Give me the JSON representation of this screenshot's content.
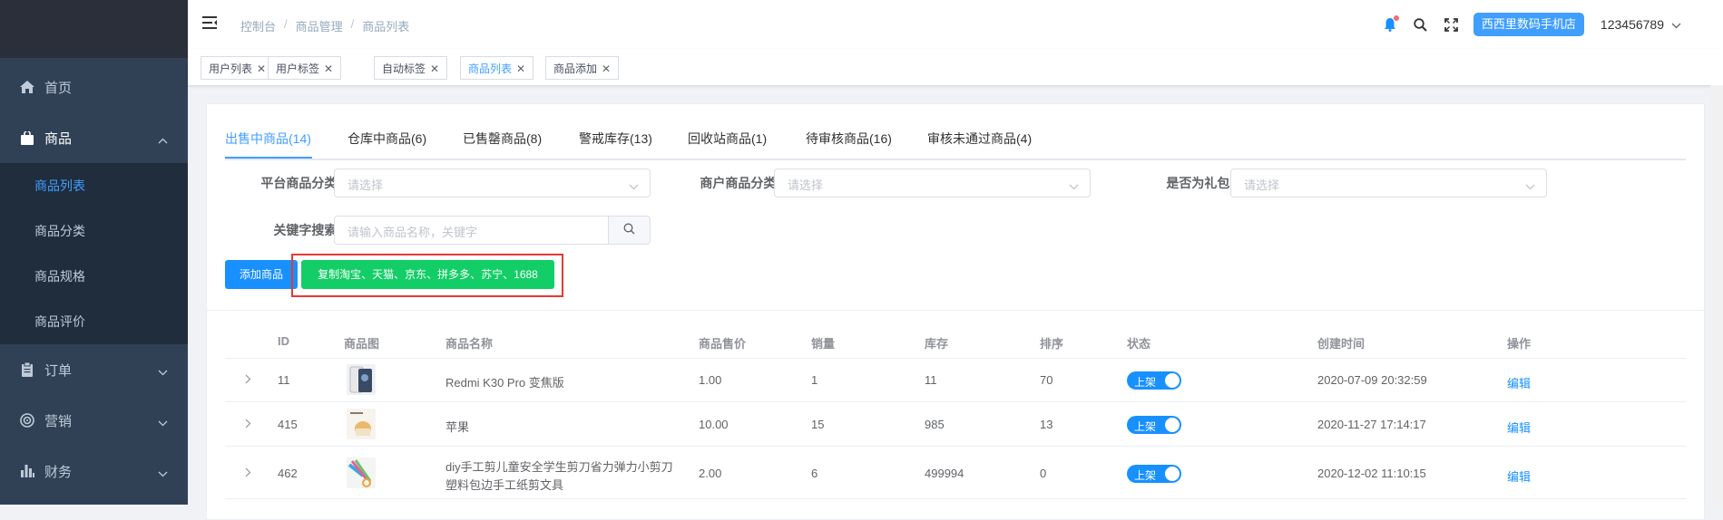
{
  "sidebar": {
    "items": [
      {
        "label": "首页",
        "icon": "home-icon"
      },
      {
        "label": "商品",
        "icon": "shopping-bag-icon"
      },
      {
        "label": "订单",
        "icon": "clipboard-icon"
      },
      {
        "label": "营销",
        "icon": "target-icon"
      },
      {
        "label": "财务",
        "icon": "bar-chart-icon"
      }
    ],
    "submenu": [
      "商品列表",
      "商品分类",
      "商品规格",
      "商品评价"
    ]
  },
  "header": {
    "breadcrumb": [
      "控制台",
      "商品管理",
      "商品列表"
    ],
    "store": "西西里数码手机店",
    "username": "123456789"
  },
  "tags": [
    "用户列表",
    "用户标签",
    "自动标签",
    "商品列表",
    "商品添加"
  ],
  "tabs": [
    "出售中商品(14)",
    "仓库中商品(6)",
    "已售罄商品(8)",
    "警戒库存(13)",
    "回收站商品(1)",
    "待审核商品(16)",
    "审核未通过商品(4)"
  ],
  "filters": {
    "platform_label": "平台商品分类:",
    "merchant_label": "商户商品分类:",
    "gift_label": "是否为礼包:",
    "keyword_label": "关键字搜索:",
    "select_placeholder": "请选择",
    "keyword_placeholder": "请输入商品名称，关键字"
  },
  "buttons": {
    "add": "添加商品",
    "copy": "复制淘宝、天猫、京东、拼多多、苏宁、1688"
  },
  "table": {
    "columns": [
      "ID",
      "商品图",
      "商品名称",
      "商品售价",
      "销量",
      "库存",
      "排序",
      "状态",
      "创建时间",
      "操作"
    ],
    "rows": [
      {
        "id": "11",
        "name": "Redmi K30 Pro 变焦版",
        "name2": "",
        "price": "1.00",
        "sales": "1",
        "stock": "11",
        "sort": "70",
        "status": "上架",
        "created": "2020-07-09 20:32:59",
        "action": "编辑"
      },
      {
        "id": "415",
        "name": "苹果",
        "name2": "",
        "price": "10.00",
        "sales": "15",
        "stock": "985",
        "sort": "13",
        "status": "上架",
        "created": "2020-11-27 17:14:17",
        "action": "编辑"
      },
      {
        "id": "462",
        "name": "diy手工剪儿童安全学生剪刀省力弹力小剪刀",
        "name2": "塑料包边手工纸剪文具",
        "price": "2.00",
        "sales": "6",
        "stock": "499994",
        "sort": "0",
        "status": "上架",
        "created": "2020-12-02 11:10:15",
        "action": "编辑"
      }
    ]
  },
  "colors": {
    "primary": "#1890ff",
    "success": "#13ce66",
    "sidebar": "#304156",
    "highlight": "#e53935"
  }
}
